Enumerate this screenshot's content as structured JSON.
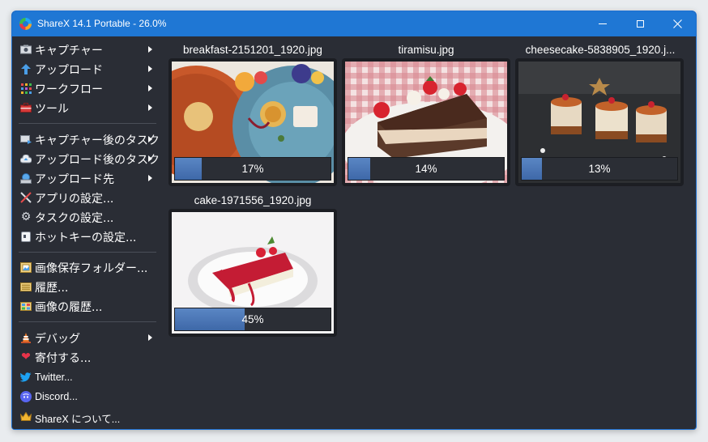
{
  "window": {
    "title": "ShareX 14.1 Portable - 26.0%"
  },
  "menu": {
    "capture": "キャプチャー",
    "upload": "アップロード",
    "workflow": "ワークフロー",
    "tools": "ツール",
    "after_capture": "キャプチャー後のタスク",
    "after_upload": "アップロード後のタスク",
    "destinations": "アップロード先",
    "app_settings": "アプリの設定...",
    "task_settings": "タスクの設定...",
    "hotkey_settings": "ホットキーの設定...",
    "screenshots_folder": "画像保存フォルダー...",
    "history": "履歴...",
    "image_history": "画像の履歴...",
    "debug": "デバッグ",
    "donate": "寄付する...",
    "twitter": "Twitter...",
    "discord": "Discord...",
    "about": "ShareX について..."
  },
  "tasks": [
    {
      "filename": "breakfast-2151201_1920.jpg",
      "progress_text": "17%",
      "progress": 0.17
    },
    {
      "filename": "tiramisu.jpg",
      "progress_text": "14%",
      "progress": 0.14
    },
    {
      "filename": "cheesecake-5838905_1920.j...",
      "progress_text": "13%",
      "progress": 0.13
    },
    {
      "filename": "cake-1971556_1920.jpg",
      "progress_text": "45%",
      "progress": 0.45
    }
  ],
  "colors": {
    "titlebar": "#1f77d4",
    "background": "#2a2d35",
    "progress_fill": "#4a76b8"
  }
}
